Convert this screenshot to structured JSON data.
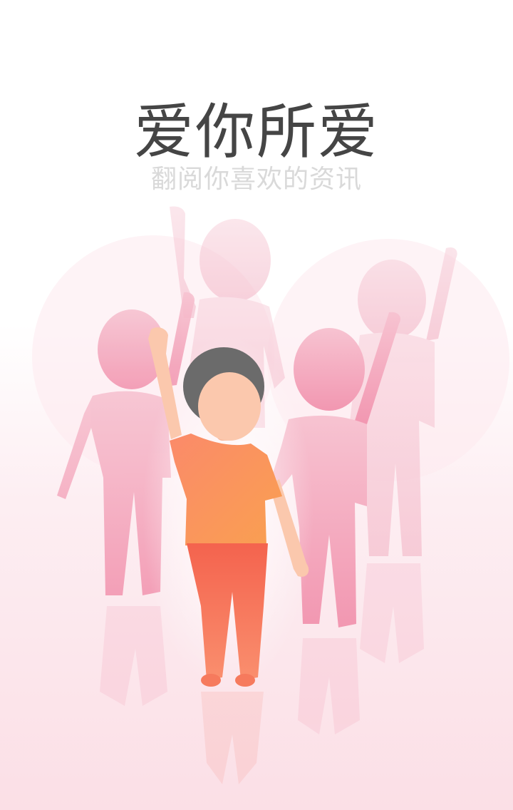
{
  "splash": {
    "headline": "爱你所爱",
    "subheadline": "翻阅你喜欢的资讯"
  },
  "illustration": {
    "name": "crowd-celebration-illustration",
    "colors": {
      "background_top": "#ffffff",
      "background_bottom": "#fbdfe6",
      "silhouette": "#f4a9bd",
      "main_shirt": "#f98f5f",
      "main_pants": "#f56f57",
      "main_hair": "#6b6b6b",
      "main_skin": "#fbc8ad",
      "headline_text": "#454545",
      "subheadline_text": "#d9d9d9"
    }
  }
}
